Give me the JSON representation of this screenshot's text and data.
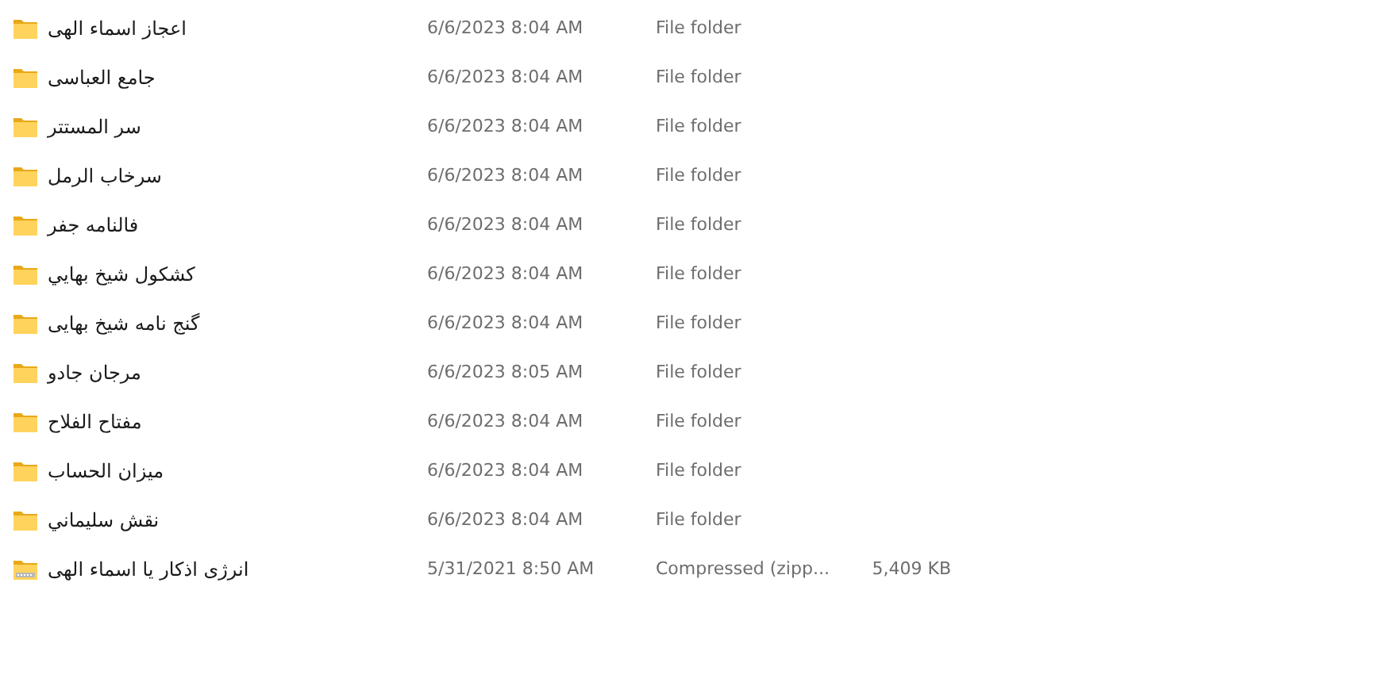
{
  "files": [
    {
      "kind": "folder",
      "name": "اعجاز اسماء الهی",
      "date": "6/6/2023 8:04 AM",
      "type": "File folder"
    },
    {
      "kind": "folder",
      "name": "جامع العباسی",
      "date": "6/6/2023 8:04 AM",
      "type": "File folder"
    },
    {
      "kind": "folder",
      "name": "سر المستتر",
      "date": "6/6/2023 8:04 AM",
      "type": "File folder"
    },
    {
      "kind": "folder",
      "name": "سرخاب الرمل",
      "date": "6/6/2023 8:04 AM",
      "type": "File folder"
    },
    {
      "kind": "folder",
      "name": "فالنامه جفر",
      "date": "6/6/2023 8:04 AM",
      "type": "File folder"
    },
    {
      "kind": "folder",
      "name": "کشکول شیخ بهايي",
      "date": "6/6/2023 8:04 AM",
      "type": "File folder"
    },
    {
      "kind": "folder",
      "name": "گنج نامه شیخ بهایی",
      "date": "6/6/2023 8:04 AM",
      "type": "File folder"
    },
    {
      "kind": "folder",
      "name": "مرجان جادو",
      "date": "6/6/2023 8:05 AM",
      "type": "File folder"
    },
    {
      "kind": "folder",
      "name": "مفتاح الفلاح",
      "date": "6/6/2023 8:04 AM",
      "type": "File folder"
    },
    {
      "kind": "folder",
      "name": "میزان الحساب",
      "date": "6/6/2023 8:04 AM",
      "type": "File folder"
    },
    {
      "kind": "folder",
      "name": "نقش سليماني",
      "date": "6/6/2023 8:04 AM",
      "type": "File folder"
    },
    {
      "kind": "zip",
      "name": "انرژی اذکار یا اسماء الهی",
      "date": "5/31/2021 8:50 AM",
      "type": "Compressed (zipp...",
      "size": "5,409 KB"
    }
  ]
}
